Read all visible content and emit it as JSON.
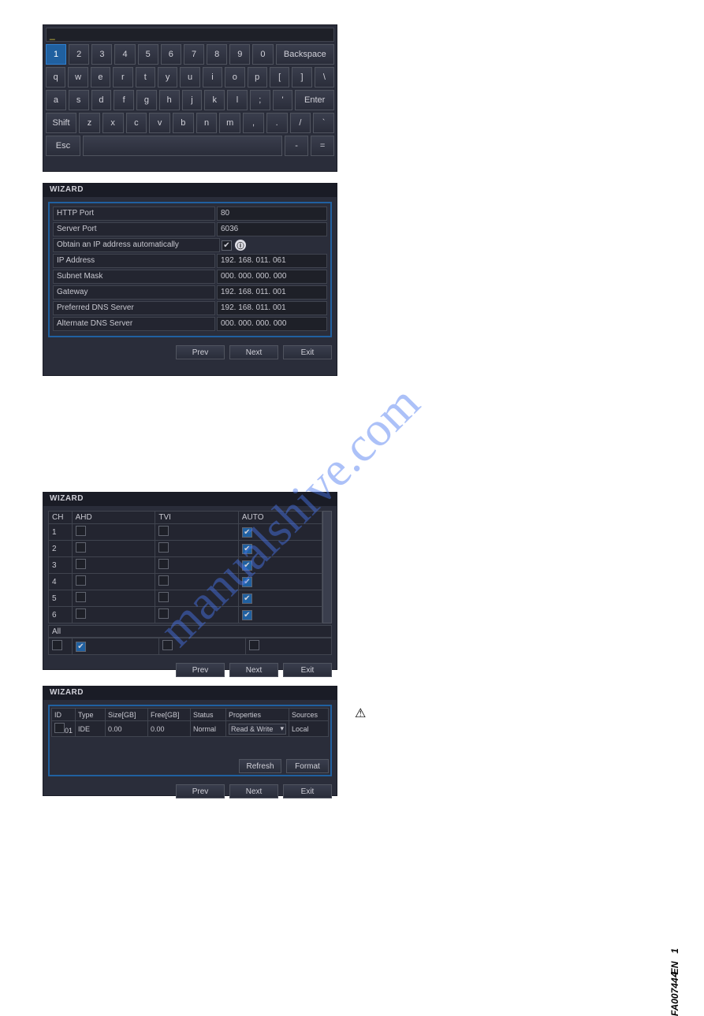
{
  "keyboard": {
    "input_value": "_",
    "rows": [
      [
        "1",
        "2",
        "3",
        "4",
        "5",
        "6",
        "7",
        "8",
        "9",
        "0",
        "Backspace"
      ],
      [
        "q",
        "w",
        "e",
        "r",
        "t",
        "y",
        "u",
        "i",
        "o",
        "p",
        "[",
        "]",
        "\\"
      ],
      [
        "a",
        "s",
        "d",
        "f",
        "g",
        "h",
        "j",
        "k",
        "l",
        ";",
        "'",
        "Enter"
      ],
      [
        "Shift",
        "z",
        "x",
        "c",
        "v",
        "b",
        "n",
        "m",
        ",",
        ".",
        "/",
        "`"
      ],
      [
        "Esc",
        " ",
        "-",
        "="
      ]
    ]
  },
  "wizard_net": {
    "title": "WIZARD",
    "fields": [
      {
        "label": "HTTP Port",
        "value": "80"
      },
      {
        "label": "Server Port",
        "value": "6036"
      },
      {
        "label": "Obtain an IP address automatically",
        "checkbox": true,
        "checked": true
      },
      {
        "label": "IP Address",
        "value": "192. 168. 011. 061"
      },
      {
        "label": "Subnet Mask",
        "value": "000. 000. 000. 000"
      },
      {
        "label": "Gateway",
        "value": "192. 168. 011. 001"
      },
      {
        "label": "Preferred DNS Server",
        "value": "192. 168. 011. 001"
      },
      {
        "label": "Alternate DNS Server",
        "value": "000. 000. 000. 000"
      }
    ],
    "buttons": {
      "prev": "Prev",
      "next": "Next",
      "exit": "Exit"
    }
  },
  "wizard_ch": {
    "title": "WIZARD",
    "headers": {
      "ch": "CH",
      "ahd": "AHD",
      "tvi": "TVI",
      "auto": "AUTO"
    },
    "rows": [
      {
        "ch": "1",
        "ahd": false,
        "tvi": false,
        "auto": true
      },
      {
        "ch": "2",
        "ahd": false,
        "tvi": false,
        "auto": true
      },
      {
        "ch": "3",
        "ahd": false,
        "tvi": false,
        "auto": true
      },
      {
        "ch": "4",
        "ahd": false,
        "tvi": false,
        "auto": true
      },
      {
        "ch": "5",
        "ahd": false,
        "tvi": false,
        "auto": true
      },
      {
        "ch": "6",
        "ahd": false,
        "tvi": false,
        "auto": true
      }
    ],
    "all_label": "All",
    "all": {
      "ahd": false,
      "ahd2": true,
      "tvi": false,
      "auto": false
    },
    "buttons": {
      "prev": "Prev",
      "next": "Next",
      "exit": "Exit"
    }
  },
  "wizard_disk": {
    "title": "WIZARD",
    "headers": {
      "id": "ID",
      "type": "Type",
      "size": "Size[GB]",
      "free": "Free[GB]",
      "status": "Status",
      "properties": "Properties",
      "sources": "Sources"
    },
    "row": {
      "id": "01",
      "type": "IDE",
      "size": "0.00",
      "free": "0.00",
      "status": "Normal",
      "properties": "Read & Write",
      "sources": "Local"
    },
    "refresh": "Refresh",
    "format": "Format",
    "buttons": {
      "prev": "Prev",
      "next": "Next",
      "exit": "Exit"
    }
  },
  "watermark": "manualshive.com",
  "warning_icon": "⚠",
  "footer": {
    "docid": "FA00744-EN",
    "seq": "1",
    "page": "4"
  }
}
